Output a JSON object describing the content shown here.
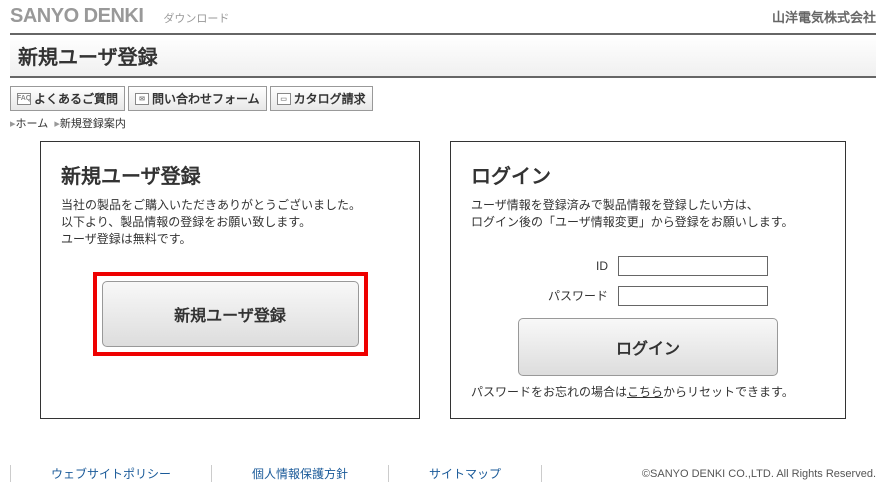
{
  "header": {
    "logo": "SANYO DENKI",
    "logo_sub": "ダウンロード",
    "company": "山洋電気株式会社"
  },
  "title": "新規ユーザ登録",
  "nav": {
    "faq": "よくあるご質問",
    "contact": "問い合わせフォーム",
    "catalog": "カタログ請求",
    "faq_icon": "FAQ",
    "mail_icon": "✉",
    "book_icon": "▭"
  },
  "breadcrumb": {
    "home": "ホーム",
    "current": "新規登録案内",
    "sep": "▸"
  },
  "register_panel": {
    "title": "新規ユーザ登録",
    "line1": "当社の製品をご購入いただきありがとうございました。",
    "line2": "以下より、製品情報の登録をお願い致します。",
    "line3": "ユーザ登録は無料です。",
    "button": "新規ユーザ登録"
  },
  "login_panel": {
    "title": "ログイン",
    "line1": "ユーザ情報を登録済みで製品情報を登録したい方は、",
    "line2": "ログイン後の「ユーザ情報変更」から登録をお願いします。",
    "id_label": "ID",
    "password_label": "パスワード",
    "button": "ログイン",
    "forgot_pre": "パスワードをお忘れの場合は",
    "forgot_link": "こちら",
    "forgot_post": "からリセットできます。"
  },
  "footer": {
    "policy": "ウェブサイトポリシー",
    "privacy": "個人情報保護方針",
    "sitemap": "サイトマップ",
    "copyright": "©SANYO DENKI CO.,LTD. All Rights Reserved."
  }
}
